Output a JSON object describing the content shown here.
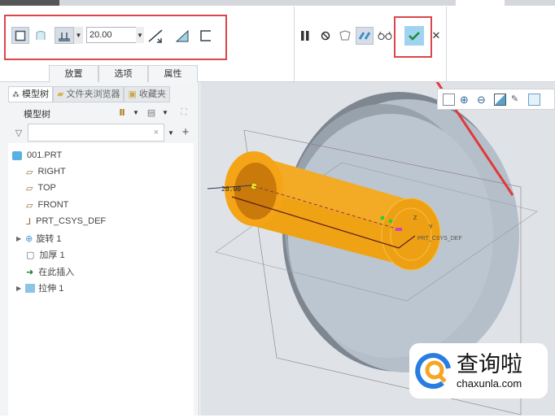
{
  "ribbon": {
    "depth_value": "20.00",
    "tabs": [
      {
        "label": "放置"
      },
      {
        "label": "选项"
      },
      {
        "label": "属性"
      }
    ]
  },
  "panel": {
    "tabs": [
      {
        "label": "模型树"
      },
      {
        "label": "文件夹浏览器"
      },
      {
        "label": "收藏夹"
      }
    ],
    "header": "模型树",
    "filter_placeholder": "",
    "clear": "×",
    "add": "+",
    "items": [
      {
        "label": "001.PRT",
        "icon": "part-icon"
      },
      {
        "label": "RIGHT",
        "icon": "datum-plane-icon"
      },
      {
        "label": "TOP",
        "icon": "datum-plane-icon"
      },
      {
        "label": "FRONT",
        "icon": "datum-plane-icon"
      },
      {
        "label": "PRT_CSYS_DEF",
        "icon": "csys-icon"
      },
      {
        "label": "旋转 1",
        "icon": "revolve-icon"
      },
      {
        "label": "加厚 1",
        "icon": "thicken-icon"
      },
      {
        "label": "在此插入",
        "icon": "insert-arrow-icon"
      },
      {
        "label": "拉伸 1",
        "icon": "extrude-icon"
      }
    ]
  },
  "viewport": {
    "dim_label": "20.00",
    "csys_label": "PRT_CSYS_DEF",
    "axis_z": "Z",
    "axis_y": "Y"
  },
  "watermark": {
    "brand": "查询啦",
    "url": "chaxunla.com"
  },
  "colors": {
    "accent_red": "#d9474b",
    "part_orange": "#f0a215",
    "confirm_bg": "#9fd3f0"
  }
}
